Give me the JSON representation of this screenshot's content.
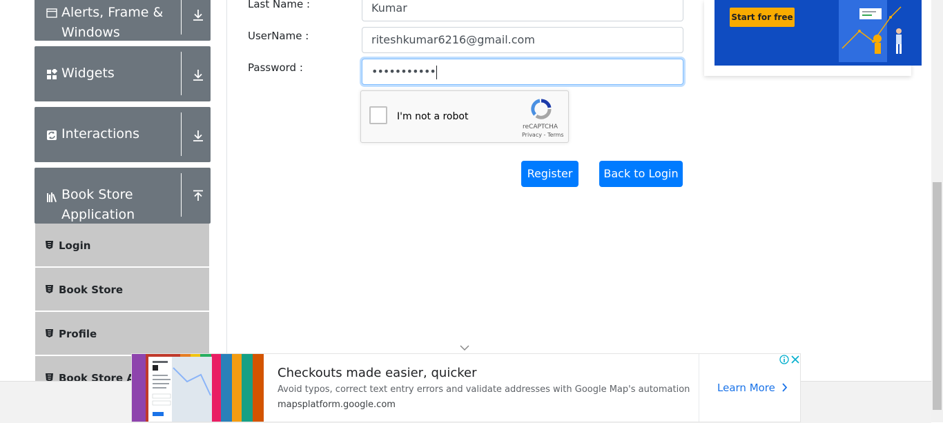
{
  "sidebar": {
    "groups": [
      {
        "label": "Alerts, Frame & Windows",
        "icon": "window-icon",
        "arrow": "download-arrow-icon"
      },
      {
        "label": "Widgets",
        "icon": "widgets-icon",
        "arrow": "download-arrow-icon"
      },
      {
        "label": "Interactions",
        "icon": "interactions-icon",
        "arrow": "download-arrow-icon"
      },
      {
        "label": "Book Store Application",
        "icon": "books-icon",
        "arrow": "upload-arrow-icon"
      }
    ],
    "items": [
      {
        "label": "Login",
        "icon": "html5-icon"
      },
      {
        "label": "Book Store",
        "icon": "html5-icon"
      },
      {
        "label": "Profile",
        "icon": "html5-icon"
      },
      {
        "label": "Book Store API",
        "icon": "html5-icon"
      }
    ]
  },
  "form": {
    "last_name_label": "Last Name :",
    "last_name_value": "Kumar",
    "username_label": "UserName :",
    "username_value": "riteshkumar6216@gmail.com",
    "password_label": "Password :",
    "password_value": "•••••••••••",
    "register_label": "Register",
    "back_label": "Back to Login"
  },
  "captcha": {
    "checkbox_label": "I'm not a robot",
    "brand": "reCAPTCHA",
    "links": "Privacy - Terms"
  },
  "right_ad": {
    "button_label": "Start for free"
  },
  "bottom_ad": {
    "title": "Checkouts made easier, quicker",
    "description": "Avoid typos, correct text entry errors and validate addresses with Google Map's automation",
    "domain": "mapsplatform.google.com",
    "cta_label": "Learn More"
  },
  "colors": {
    "sidebar_header": "#6c757d",
    "sidebar_item": "#c8c8c8",
    "primary": "#007bff",
    "ad_blue": "#0f4cc1",
    "ad_button": "#f9ab00"
  }
}
